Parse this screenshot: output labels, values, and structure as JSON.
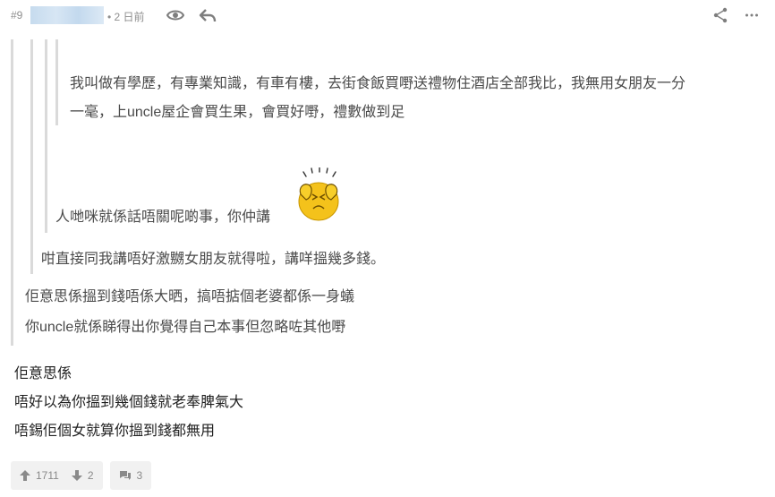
{
  "header": {
    "post_number": "#9",
    "time_ago": "• 2 日前"
  },
  "quotes": {
    "level4_lines": [
      "我叫做有學歷，有專業知識，有車有樓，去街食飯買嘢送禮物住酒店全部我比，我無用女朋友一分",
      "一毫，上uncle屋企會買生果，會買好嘢，禮數做到足"
    ],
    "level3_text": "人哋咪就係話唔關呢啲事，你仲講",
    "level2_text": "咁直接同我講唔好激嬲女朋友就得啦，講咩搵幾多錢。",
    "level1_lines": [
      "佢意思係搵到錢唔係大晒，搞唔掂個老婆都係一身蟻",
      "你uncle就係睇得出你覺得自己本事但忽略咗其他嘢"
    ]
  },
  "reply_lines": [
    "佢意思係",
    "唔好以為你搵到幾個錢就老奉脾氣大",
    "唔錫佢個女就算你搵到錢都無用"
  ],
  "footer": {
    "upvotes": "1711",
    "downvotes": "2",
    "comments": "3"
  },
  "icons": {
    "view": "eye-icon",
    "reply": "reply-arrow-icon",
    "share": "share-icon",
    "more": "more-dots-icon",
    "up": "arrow-up-icon",
    "down": "arrow-down-icon",
    "comment": "comment-icon",
    "sticker": "frustrated-sticker"
  }
}
